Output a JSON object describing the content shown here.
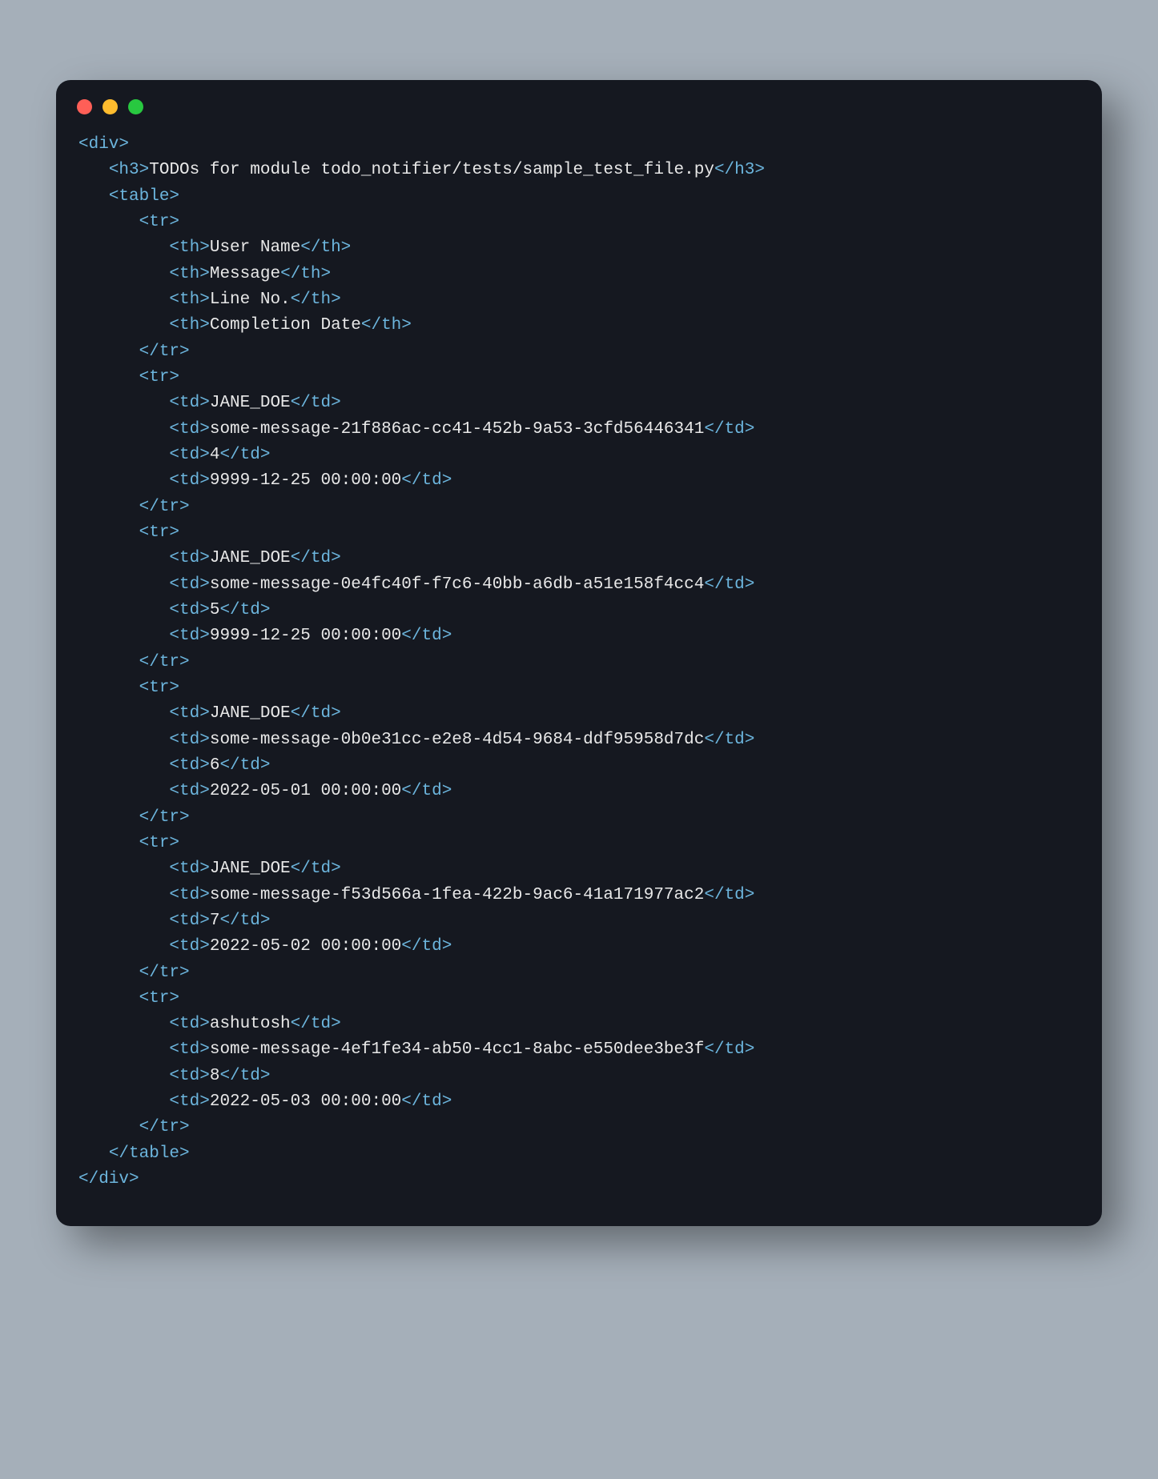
{
  "code": {
    "h3_text": "TODOs for module todo_notifier/tests/sample_test_file.py",
    "headers": [
      "User Name",
      "Message",
      "Line No.",
      "Completion Date"
    ],
    "rows": [
      {
        "user": "JANE_DOE",
        "msg": "some-message-21f886ac-cc41-452b-9a53-3cfd56446341",
        "line": "4",
        "date": "9999-12-25 00:00:00"
      },
      {
        "user": "JANE_DOE",
        "msg": "some-message-0e4fc40f-f7c6-40bb-a6db-a51e158f4cc4",
        "line": "5",
        "date": "9999-12-25 00:00:00"
      },
      {
        "user": "JANE_DOE",
        "msg": "some-message-0b0e31cc-e2e8-4d54-9684-ddf95958d7dc",
        "line": "6",
        "date": "2022-05-01 00:00:00"
      },
      {
        "user": "JANE_DOE",
        "msg": "some-message-f53d566a-1fea-422b-9ac6-41a171977ac2",
        "line": "7",
        "date": "2022-05-02 00:00:00"
      },
      {
        "user": "ashutosh",
        "msg": "some-message-4ef1fe34-ab50-4cc1-8abc-e550dee3be3f",
        "line": "8",
        "date": "2022-05-03 00:00:00"
      }
    ]
  }
}
